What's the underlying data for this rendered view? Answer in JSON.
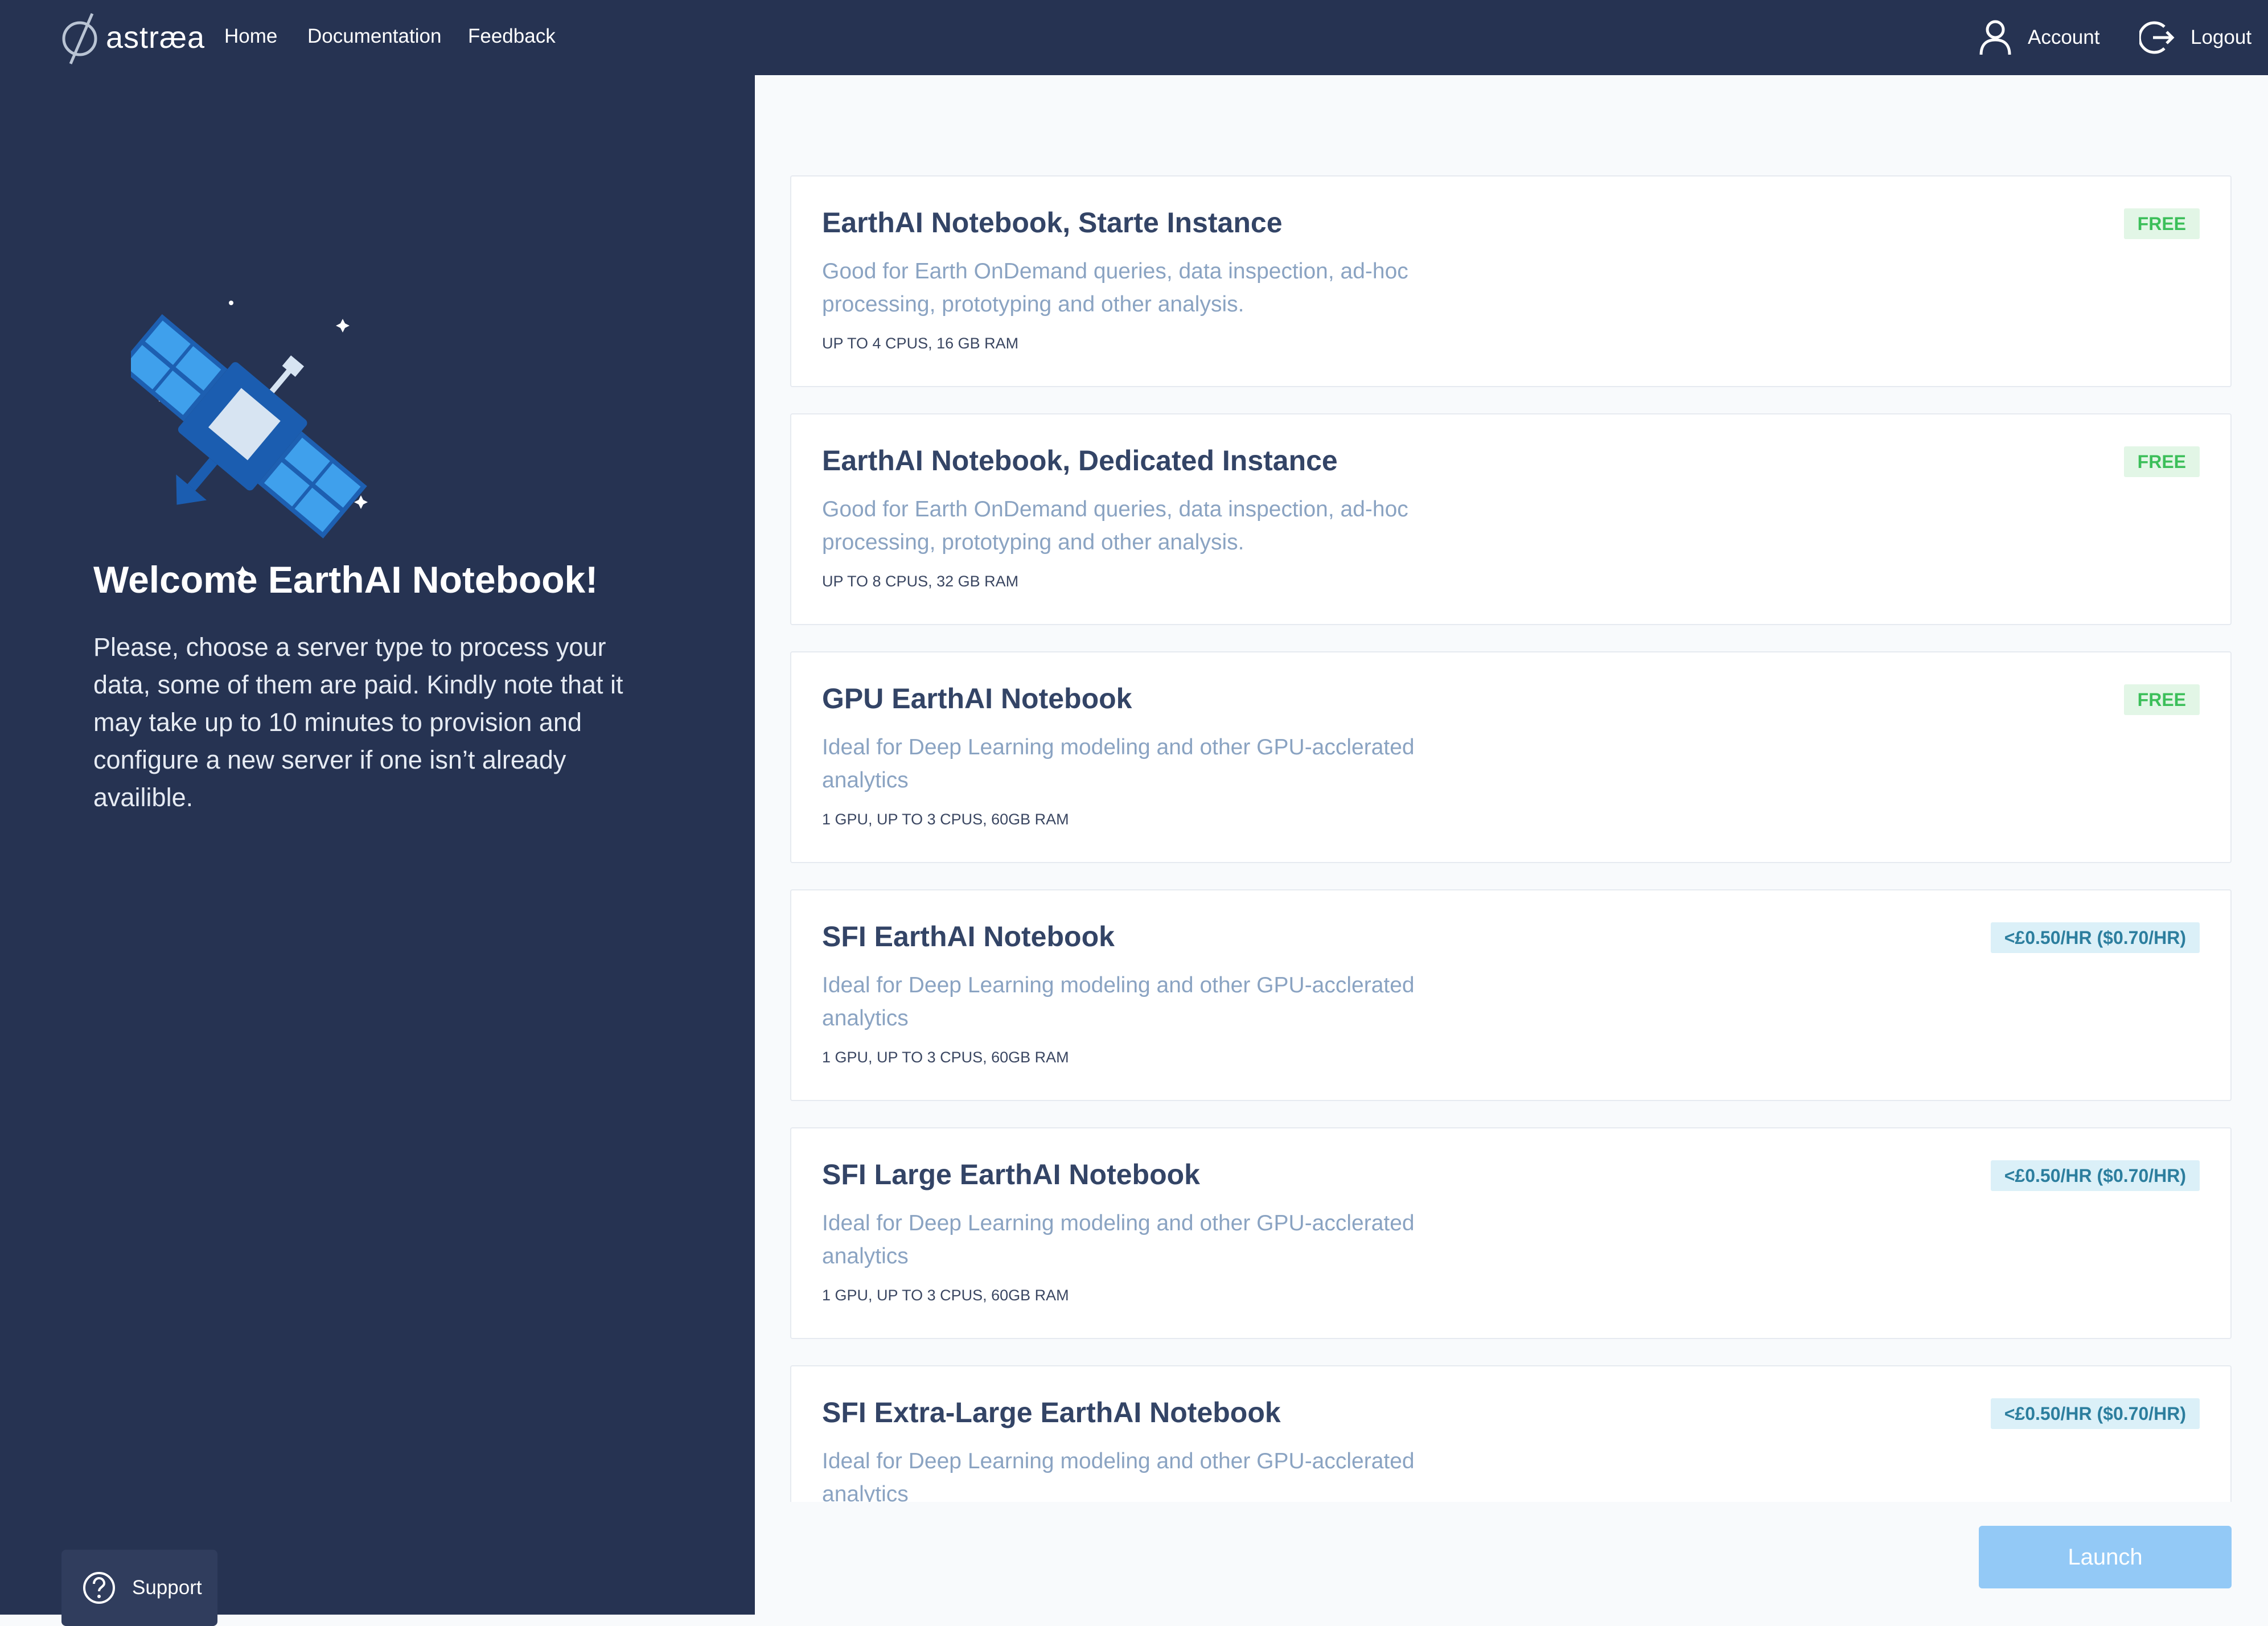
{
  "nav": {
    "logo_text": "astræa",
    "links": [
      "Home",
      "Documentation",
      "Feedback"
    ],
    "account_label": "Account",
    "logout_label": "Logout"
  },
  "welcome": {
    "title": "Welcome EarthAI Notebook!",
    "text": "Please, choose a server type to process your data, some of them are paid. Kindly note that it may take up to 10 minutes to provision and configure a new server if one isn’t already availible."
  },
  "support_label": "Support",
  "servers": [
    {
      "title": "EarthAI Notebook, Starte Instance",
      "description": "Good for Earth OnDemand queries, data inspection, ad-hoc processing, prototyping and other analysis.",
      "specs": "UP TO 4 CPUS, 16 GB RAM",
      "price": "FREE",
      "paid": false
    },
    {
      "title": "EarthAI Notebook, Dedicated Instance",
      "description": "Good for Earth OnDemand queries, data inspection, ad-hoc processing, prototyping and other analysis.",
      "specs": "UP TO 8 CPUS, 32 GB RAM",
      "price": "FREE",
      "paid": false
    },
    {
      "title": "GPU EarthAI Notebook",
      "description": "Ideal for Deep Learning modeling and other GPU-acclerated analytics",
      "specs": "1 GPU, UP TO 3 CPUS, 60GB RAM",
      "price": "FREE",
      "paid": false
    },
    {
      "title": "SFI EarthAI Notebook",
      "description": "Ideal for Deep Learning modeling and other GPU-acclerated analytics",
      "specs": "1 GPU, UP TO 3 CPUS, 60GB RAM",
      "price": "<£0.50/HR ($0.70/HR)",
      "paid": true
    },
    {
      "title": "SFI Large EarthAI Notebook",
      "description": "Ideal for Deep Learning modeling and other GPU-acclerated analytics",
      "specs": "1 GPU, UP TO 3 CPUS, 60GB RAM",
      "price": "<£0.50/HR ($0.70/HR)",
      "paid": true
    },
    {
      "title": "SFI Extra-Large EarthAI Notebook",
      "description": "Ideal for Deep Learning modeling and other GPU-acclerated analytics",
      "specs": "",
      "price": "<£0.50/HR ($0.70/HR)",
      "paid": true
    }
  ],
  "launch_label": "Launch"
}
